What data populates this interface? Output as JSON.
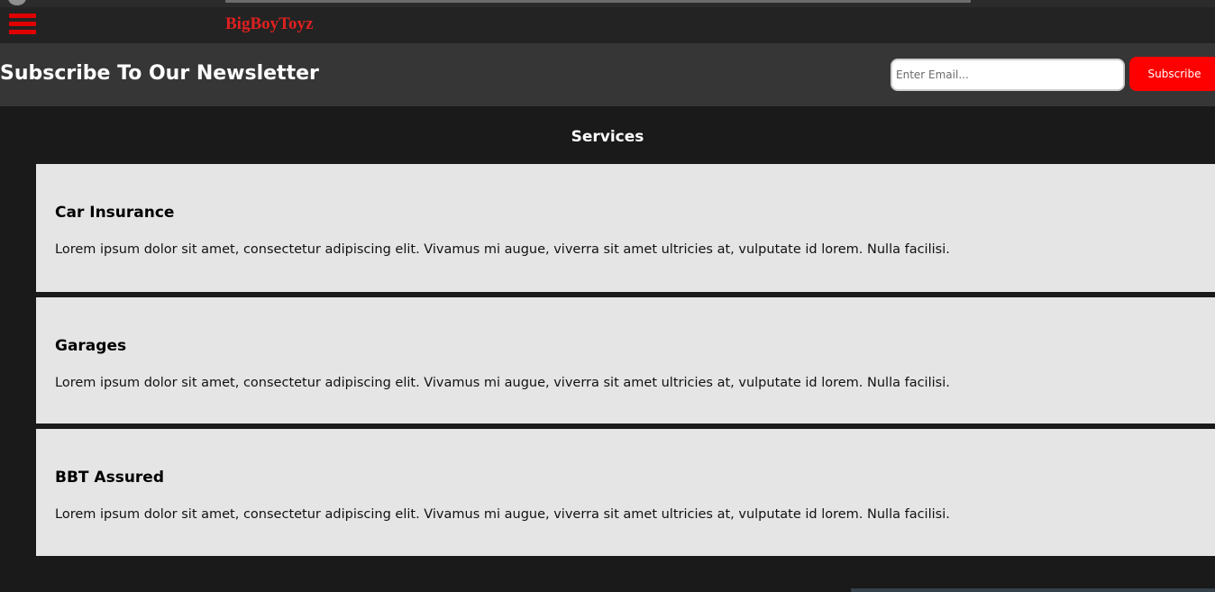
{
  "brand": {
    "name": "BigBoyToyz"
  },
  "newsletter": {
    "title": "Subscribe To Our Newsletter",
    "email_placeholder": "Enter Email...",
    "email_value": "",
    "subscribe_label": "Subscribe"
  },
  "services": {
    "heading": "Services",
    "items": [
      {
        "title": "Car Insurance",
        "description": "Lorem ipsum dolor sit amet, consectetur adipiscing elit. Vivamus mi augue, viverra sit amet ultricies at, vulputate id lorem. Nulla facilisi."
      },
      {
        "title": "Garages",
        "description": "Lorem ipsum dolor sit amet, consectetur adipiscing elit. Vivamus mi augue, viverra sit amet ultricies at, vulputate id lorem. Nulla facilisi."
      },
      {
        "title": "BBT Assured",
        "description": "Lorem ipsum dolor sit amet, consectetur adipiscing elit. Vivamus mi augue, viverra sit amet ultricies at, vulputate id lorem. Nulla facilisi."
      }
    ]
  },
  "icons": {
    "menu": "hamburger-menu-icon"
  },
  "colors": {
    "accent": "#ff0000",
    "brand_text": "#e02020",
    "page_background": "#1a1a1a",
    "card_background": "#e5e5e5"
  }
}
